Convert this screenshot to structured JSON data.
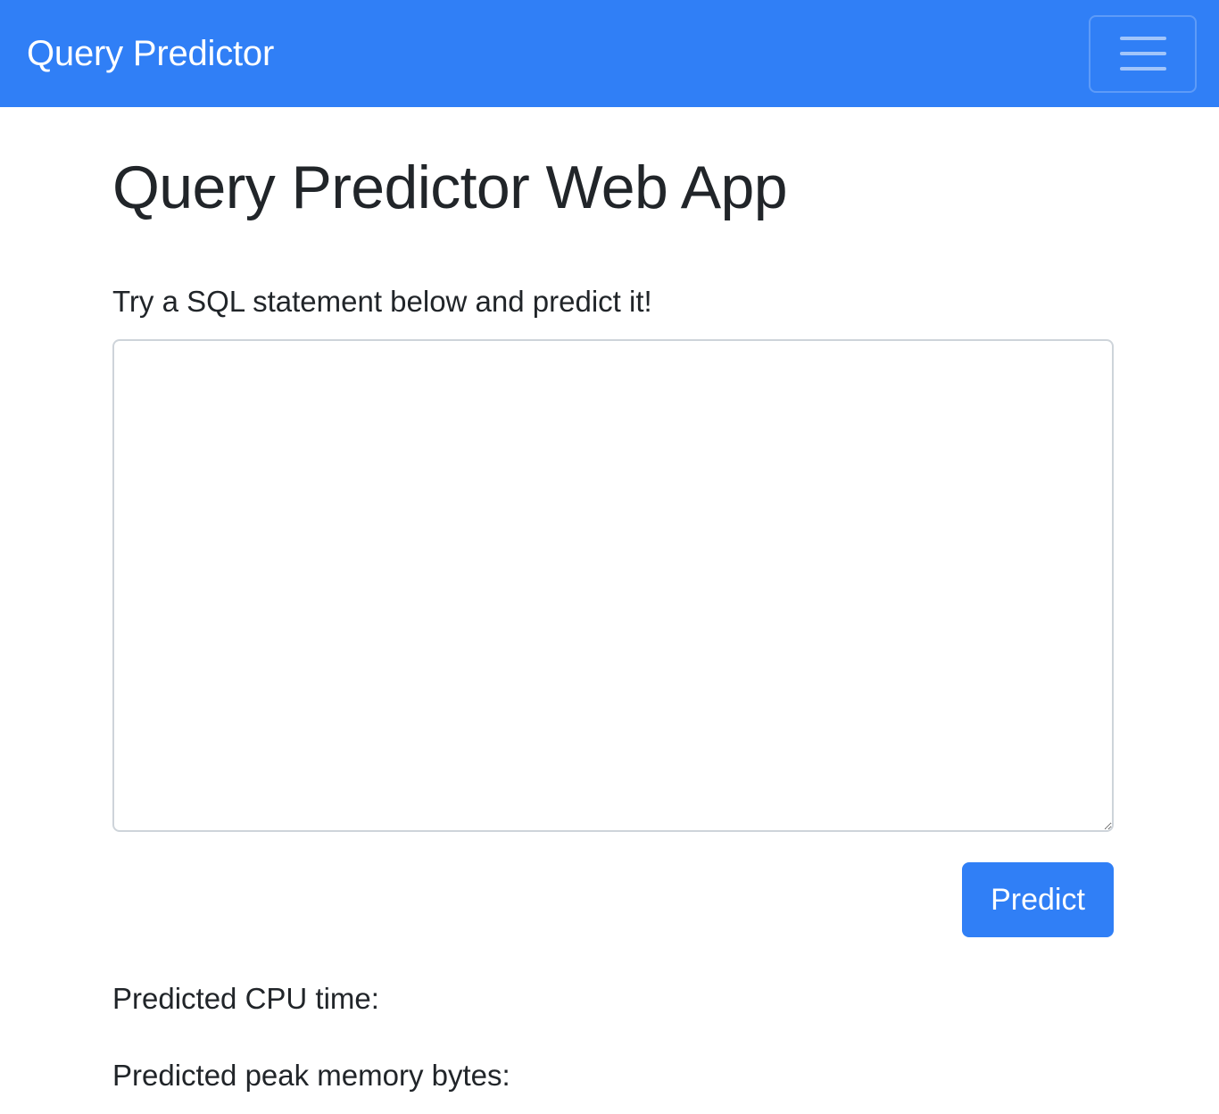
{
  "navbar": {
    "brand": "Query Predictor",
    "toggler_icon": "hamburger-menu-icon"
  },
  "main": {
    "title": "Query Predictor Web App",
    "prompt": "Try a SQL statement below and predict it!",
    "sql_input": {
      "value": "",
      "placeholder": ""
    },
    "predict_label": "Predict",
    "results": {
      "cpu_label": "Predicted CPU time:",
      "memory_label": "Predicted peak memory bytes:"
    }
  },
  "colors": {
    "primary": "#307ff6",
    "text": "#212529",
    "border": "#ced4da",
    "background": "#ffffff"
  }
}
